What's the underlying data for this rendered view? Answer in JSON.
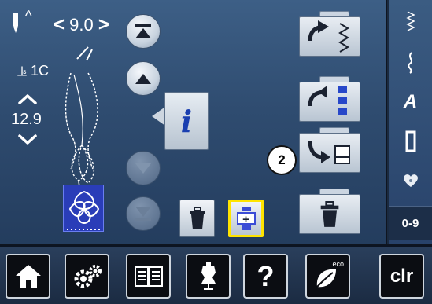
{
  "status": {
    "stitch_width": "9.0",
    "presser_foot": "1C",
    "stitch_length": "12.9"
  },
  "main": {
    "callout_number": "2",
    "combination_button_label": "+"
  },
  "right_bar": {
    "alphabet_label": "A",
    "quick_select_label": "0-9"
  },
  "bottom_bar": {
    "help_label": "?",
    "eco_label": "eco",
    "clear_label": "clr"
  },
  "colors": {
    "background_top": "#3d5f86",
    "background_bottom": "#243d5e",
    "highlight": "#ffe400",
    "stitch_tile": "#2a3db8",
    "folder_icon_blue": "#2747c9",
    "info_blue": "#1a3fb0"
  },
  "icons": {
    "needle": "needle-icon",
    "arrow_up": "chevron-up-icon",
    "arrow_down": "chevron-down-icon",
    "pattern_start": "pattern-start-icon",
    "info": "info-icon",
    "trash": "trash-icon",
    "home": "home-icon",
    "setup": "gear-icon",
    "tutorial": "book-icon",
    "consultant": "dress-form-icon",
    "heart": "heart-icon"
  }
}
